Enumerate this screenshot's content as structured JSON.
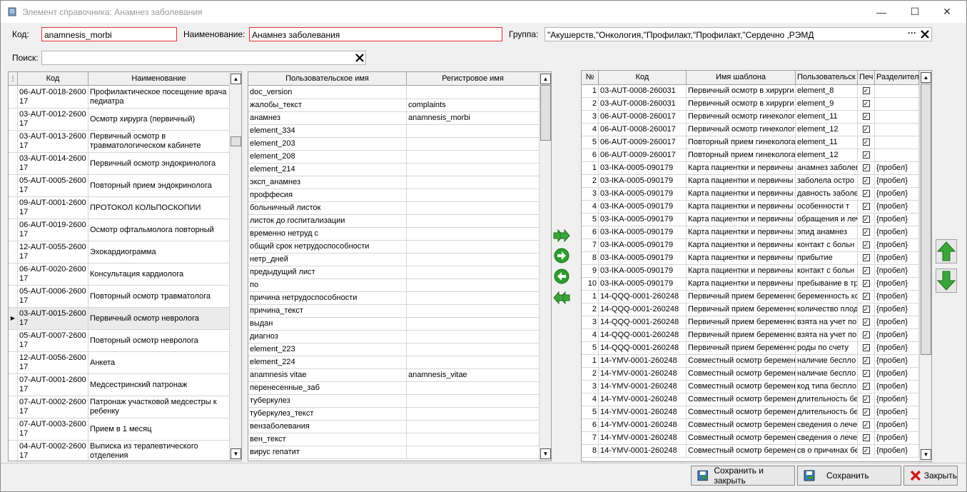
{
  "window": {
    "title": "Элемент справочника: Анамнез заболевания",
    "minimize": "—",
    "maximize": "☐",
    "close": "✕"
  },
  "form": {
    "code_label": "Код:",
    "code_value": "anamnesis_morbi",
    "name_label": "Наименование:",
    "name_value": "Анамнез заболевания",
    "group_label": "Группа:",
    "group_value": "\"Акушерств,\"Онкология,\"Профилакт,\"Профилакт,\"Сердечно ,РЭМД",
    "group_more": "···",
    "search_label": "Поиск:",
    "search_value": ""
  },
  "left_grid": {
    "headers": [
      "Код",
      "Наименование"
    ],
    "rows": [
      {
        "code": "06-AUT-0018-2600\n17",
        "name": "Профилактическое посещение врача\nпедиатра"
      },
      {
        "code": "03-AUT-0012-2600\n17",
        "name": "Осмотр хирурга (первичный)"
      },
      {
        "code": "03-AUT-0013-2600\n17",
        "name": "Первичный осмотр в\nтравматологическом кабинете"
      },
      {
        "code": "03-AUT-0014-2600\n17",
        "name": "Первичный осмотр эндокринолога"
      },
      {
        "code": "05-AUT-0005-2600\n17",
        "name": "Повторный прием эндокринолога"
      },
      {
        "code": "09-AUT-0001-2600\n17",
        "name": "ПРОТОКОЛ КОЛЬПОСКОПИИ"
      },
      {
        "code": "06-AUT-0019-2600\n17",
        "name": "Осмотр офтальмолога повторный"
      },
      {
        "code": "12-AUT-0055-2600\n17",
        "name": "Эхокардиограмма"
      },
      {
        "code": "06-AUT-0020-2600\n17",
        "name": "Консультация кардиолога"
      },
      {
        "code": "05-AUT-0006-2600\n17",
        "name": "Повторный осмотр травматолога"
      },
      {
        "code": "03-AUT-0015-2600\n17",
        "name": "Первичный осмотр невролога"
      },
      {
        "code": "05-AUT-0007-2600\n17",
        "name": "Повторный осмотр невролога"
      },
      {
        "code": "12-AUT-0056-2600\n17",
        "name": "Анкета"
      },
      {
        "code": "07-AUT-0001-2600\n17",
        "name": "Медсестринский патронаж"
      },
      {
        "code": "07-AUT-0002-2600\n17",
        "name": "Патронаж участковой медсестры к\nребенку"
      },
      {
        "code": "07-AUT-0003-2600\n17",
        "name": "Прием в 1 месяц"
      },
      {
        "code": "04-AUT-0002-2600\n17",
        "name": "Выписка из терапевтического\nотделения"
      }
    ],
    "selected_index": 10
  },
  "mid_grid": {
    "headers": [
      "Пользовательское имя",
      "Регистровое имя"
    ],
    "rows": [
      [
        "doc_version",
        ""
      ],
      [
        "жалобы_текст",
        "complaints"
      ],
      [
        "анамнез",
        "anamnesis_morbi"
      ],
      [
        "element_334",
        ""
      ],
      [
        "element_203",
        ""
      ],
      [
        "element_208",
        ""
      ],
      [
        "element_214",
        ""
      ],
      [
        "эксп_анамнез",
        ""
      ],
      [
        "проффесия",
        ""
      ],
      [
        "больничный листок",
        ""
      ],
      [
        "листок до госпитализации",
        ""
      ],
      [
        "временно нетруд с",
        ""
      ],
      [
        "общий срок нетрудоспособности",
        ""
      ],
      [
        "нетр_дней",
        ""
      ],
      [
        "предыдущий лист",
        ""
      ],
      [
        "по",
        ""
      ],
      [
        "причина нетрудоспособности",
        ""
      ],
      [
        "причина_текст",
        ""
      ],
      [
        "выдан",
        ""
      ],
      [
        "диагноз",
        ""
      ],
      [
        "element_223",
        ""
      ],
      [
        "element_224",
        ""
      ],
      [
        "anamnesis vitae",
        "anamnesis_vitae"
      ],
      [
        "перенесенные_заб",
        ""
      ],
      [
        "туберкулез",
        ""
      ],
      [
        "туберкулез_текст",
        ""
      ],
      [
        "вензаболевания",
        ""
      ],
      [
        "вен_текст",
        ""
      ],
      [
        "вирус гепатит",
        ""
      ]
    ]
  },
  "right_grid": {
    "headers": [
      "№",
      "Код",
      "Имя шаблона",
      "Пользовательск",
      "Печ",
      "Разделител"
    ],
    "rows": [
      [
        "1",
        "03-AUT-0008-260031",
        "Первичный осмотр в хирурги",
        "element_8",
        true,
        ""
      ],
      [
        "2",
        "03-AUT-0008-260031",
        "Первичный осмотр в хирурги",
        "element_9",
        true,
        ""
      ],
      [
        "3",
        "06-AUT-0008-260017",
        "Первичный осмотр гинеколог",
        "element_11",
        true,
        ""
      ],
      [
        "4",
        "06-AUT-0008-260017",
        "Первичный осмотр гинеколог",
        "element_12",
        true,
        ""
      ],
      [
        "5",
        "06-AUT-0009-260017",
        "Повторный прием гинеколога",
        "element_11",
        true,
        ""
      ],
      [
        "6",
        "06-AUT-0009-260017",
        "Повторный прием гинеколога",
        "element_12",
        true,
        ""
      ],
      [
        "1",
        "03-IKA-0005-090179",
        "Карта пациентки и первичны",
        "анамнез заболев",
        true,
        "{пробел}"
      ],
      [
        "2",
        "03-IKA-0005-090179",
        "Карта пациентки и первичны",
        "заболела остро",
        true,
        "{пробел}"
      ],
      [
        "3",
        "03-IKA-0005-090179",
        "Карта пациентки и первичны",
        "давность заболе",
        true,
        "{пробел}"
      ],
      [
        "4",
        "03-IKA-0005-090179",
        "Карта пациентки и первичны",
        "особенности т",
        true,
        "{пробел}"
      ],
      [
        "5",
        "03-IKA-0005-090179",
        "Карта пациентки и первичны",
        "обращения и леч",
        true,
        "{пробел}"
      ],
      [
        "6",
        "03-IKA-0005-090179",
        "Карта пациентки и первичны",
        "эпид анамнез",
        true,
        "{пробел}"
      ],
      [
        "7",
        "03-IKA-0005-090179",
        "Карта пациентки и первичны",
        "контакт с больн",
        true,
        "{пробел}"
      ],
      [
        "8",
        "03-IKA-0005-090179",
        "Карта пациентки и первичны",
        "прибытие",
        true,
        "{пробел}"
      ],
      [
        "9",
        "03-IKA-0005-090179",
        "Карта пациентки и первичны",
        "контакт с больн",
        true,
        "{пробел}"
      ],
      [
        "10",
        "03-IKA-0005-090179",
        "Карта пациентки и первичны",
        "пребывание в тр",
        true,
        "{пробел}"
      ],
      [
        "1",
        "14-QQQ-0001-260248",
        "Первичный прием беременно",
        "беременность ко",
        true,
        "{пробел}"
      ],
      [
        "2",
        "14-QQQ-0001-260248",
        "Первичный прием беременно",
        "количество плод",
        true,
        "{пробел}"
      ],
      [
        "3",
        "14-QQQ-0001-260248",
        "Первичный прием беременно",
        "взята на учет по",
        true,
        "{пробел}"
      ],
      [
        "4",
        "14-QQQ-0001-260248",
        "Первичный прием беременно",
        "взята на учет по",
        true,
        "{пробел}"
      ],
      [
        "5",
        "14-QQQ-0001-260248",
        "Первичный прием беременно",
        "роды по счету",
        true,
        "{пробел}"
      ],
      [
        "1",
        "14-YMV-0001-260248",
        "Совместный осмотр беремен",
        "наличие беспло",
        true,
        "{пробел}"
      ],
      [
        "2",
        "14-YMV-0001-260248",
        "Совместный осмотр беремен",
        "наличие беспло",
        true,
        "{пробел}"
      ],
      [
        "3",
        "14-YMV-0001-260248",
        "Совместный осмотр беремен",
        "код типа беспло",
        true,
        "{пробел}"
      ],
      [
        "4",
        "14-YMV-0001-260248",
        "Совместный осмотр беремен",
        "длительность бе",
        true,
        "{пробел}"
      ],
      [
        "5",
        "14-YMV-0001-260248",
        "Совместный осмотр беремен",
        "длительность бе",
        true,
        "{пробел}"
      ],
      [
        "6",
        "14-YMV-0001-260248",
        "Совместный осмотр беремен",
        "сведения о лече",
        true,
        "{пробел}"
      ],
      [
        "7",
        "14-YMV-0001-260248",
        "Совместный осмотр беремен",
        "сведения о лече",
        true,
        "{пробел}"
      ],
      [
        "8",
        "14-YMV-0001-260248",
        "Совместный осмотр беремен",
        "св о причинах бе",
        true,
        "{пробел}"
      ]
    ]
  },
  "footer": {
    "save_close": "Сохранить и закрыть",
    "save": "Сохранить",
    "close": "Закрыть"
  },
  "colors": {
    "required_border": "#e03030",
    "arrow_green": "#2e9e2e"
  }
}
